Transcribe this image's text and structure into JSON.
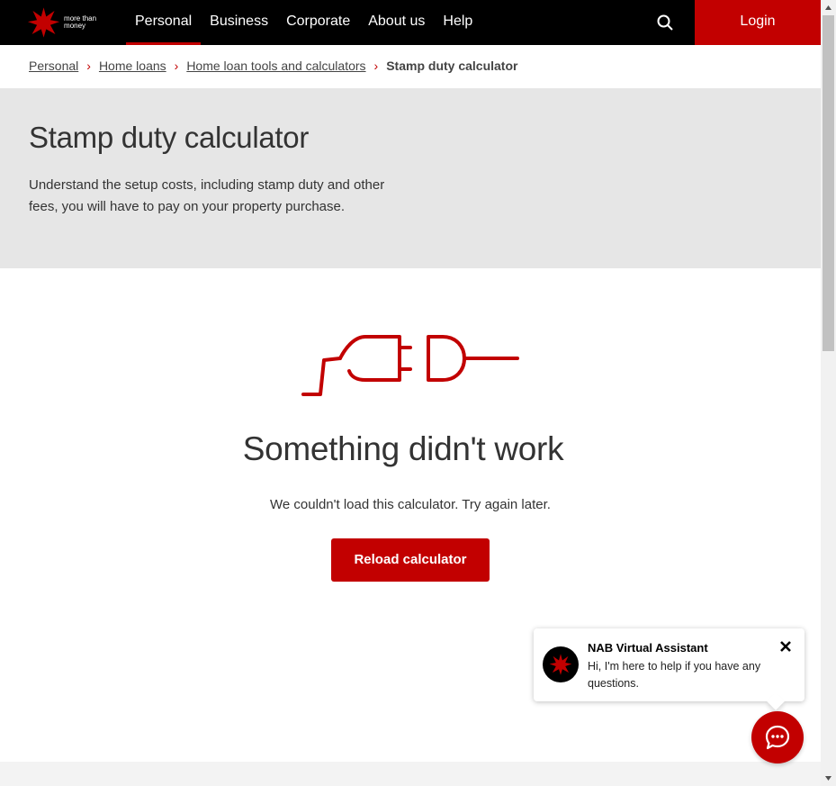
{
  "header": {
    "logo_text": "more than money",
    "nav": [
      "Personal",
      "Business",
      "Corporate",
      "About us",
      "Help"
    ],
    "login_label": "Login"
  },
  "breadcrumb": {
    "items": [
      "Personal",
      "Home loans",
      "Home loan tools and calculators"
    ],
    "current": "Stamp duty calculator"
  },
  "hero": {
    "title": "Stamp duty calculator",
    "description": "Understand the setup costs, including stamp duty and other fees, you will have to pay on your property purchase."
  },
  "error": {
    "title": "Something didn't work",
    "message": "We couldn't load this calculator. Try again later.",
    "button_label": "Reload calculator"
  },
  "chat": {
    "name": "NAB Virtual Assistant",
    "message": "Hi, I'm here to help if you have any questions."
  },
  "colors": {
    "brand_red": "#c20000",
    "header_bg": "#000000",
    "hero_bg": "#e6e6e6"
  },
  "icons": {
    "logo": "nab-star-icon",
    "search": "search-icon",
    "plug": "unplugged-icon",
    "close": "close-icon",
    "chat": "chat-bubble-icon"
  }
}
